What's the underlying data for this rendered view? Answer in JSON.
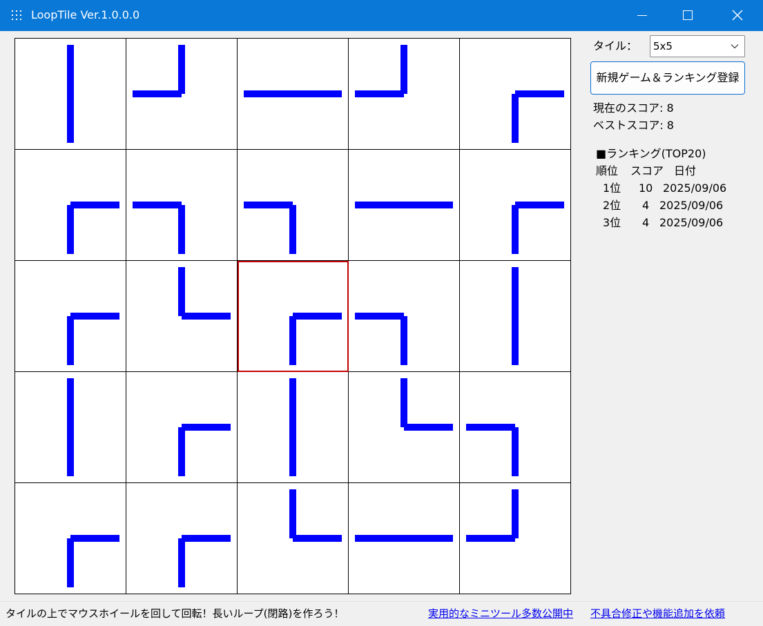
{
  "window": {
    "title": "LoopTile Ver.1.0.0.0",
    "app_icon": "grid-dots-icon",
    "controls": [
      "minimize-icon",
      "maximize-icon",
      "close-icon"
    ]
  },
  "board": {
    "size": 5,
    "selected": [
      2,
      2
    ],
    "line_color": "#0000ff",
    "selected_color": "#c00000",
    "tiles": [
      [
        "vertical",
        "corner-up-left",
        "horizontal",
        "corner-up-left",
        "corner-down-right"
      ],
      [
        "corner-down-right",
        "corner-down-left",
        "corner-down-left",
        "horizontal",
        "corner-down-right"
      ],
      [
        "corner-down-right",
        "corner-up-right",
        "corner-down-right",
        "corner-down-left",
        "vertical"
      ],
      [
        "vertical",
        "corner-down-right",
        "vertical",
        "corner-up-right",
        "corner-down-left"
      ],
      [
        "corner-down-right",
        "corner-down-right",
        "corner-up-right",
        "horizontal",
        "corner-up-left"
      ]
    ]
  },
  "side": {
    "tile_label": "タイル：",
    "tile_select_value": "5x5",
    "new_game_label": "新規ゲーム＆ランキング登録",
    "current_score": "現在のスコア: 8",
    "best_score": "ベストスコア: 8",
    "ranking_title": "■ランキング(TOP20)",
    "ranking_headers": [
      "順位",
      "スコア",
      "日付"
    ],
    "ranking_rows": [
      [
        "1位",
        "10",
        "2025/09/06"
      ],
      [
        "2位",
        "4",
        "2025/09/06"
      ],
      [
        "3位",
        "4",
        "2025/09/06"
      ]
    ]
  },
  "status": {
    "hint": "タイルの上でマウスホイールを回して回転！長いループ(閉路)を作ろう！",
    "link1": "実用的なミニツール多数公開中",
    "link2": "不具合修正や機能追加を依頼"
  }
}
